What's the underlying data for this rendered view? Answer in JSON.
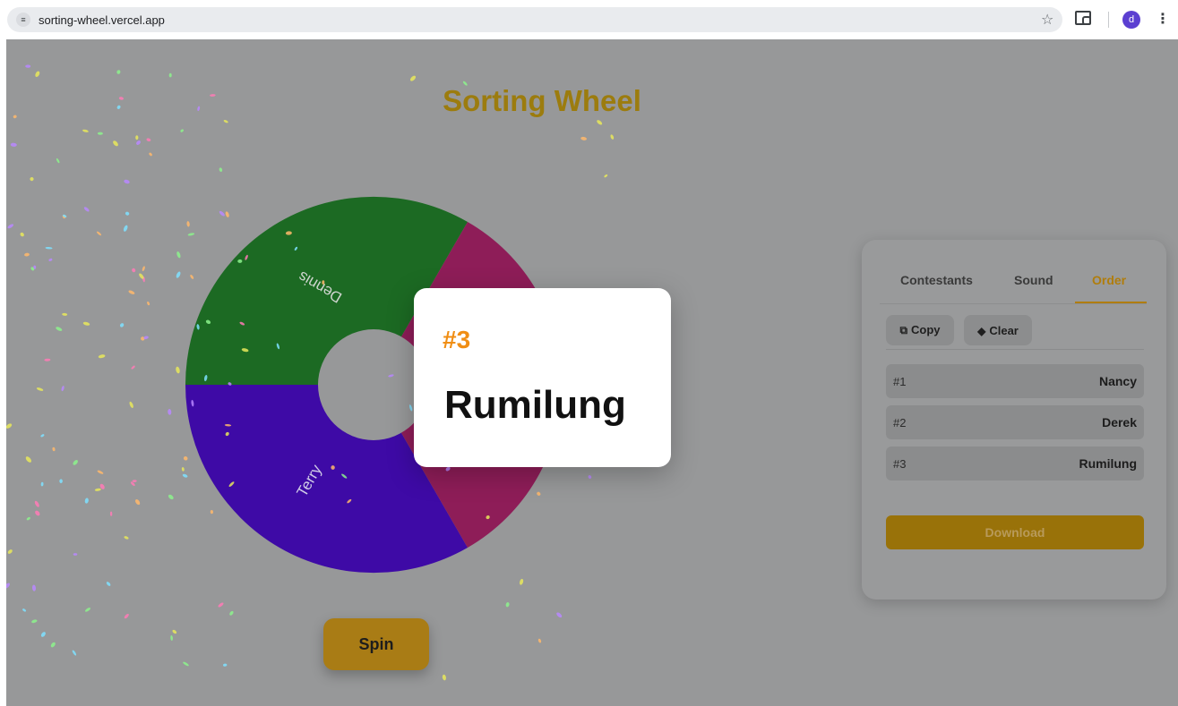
{
  "browser": {
    "url": "sorting-wheel.vercel.app",
    "profile_initial": "d"
  },
  "app": {
    "title": "Sorting Wheel",
    "spin_label": "Spin"
  },
  "wheel": {
    "segments": [
      {
        "name": "Dennis",
        "color": "#1c6a23"
      },
      {
        "name": "Terry",
        "color": "#3e0aa6"
      },
      {
        "name": "Rumilung",
        "color": "#8e1d58"
      }
    ]
  },
  "panel": {
    "tabs": [
      {
        "label": "Contestants"
      },
      {
        "label": "Sound"
      },
      {
        "label": "Order"
      }
    ],
    "active_tab": "Order",
    "copy_label": "Copy",
    "clear_label": "Clear",
    "order": [
      {
        "rank": "#1",
        "name": "Nancy"
      },
      {
        "rank": "#2",
        "name": "Derek"
      },
      {
        "rank": "#3",
        "name": "Rumilung"
      }
    ],
    "download_label": "Download"
  },
  "result": {
    "rank": "#3",
    "name": "Rumilung"
  },
  "colors": {
    "accent": "#b07d0c",
    "overlay": "#979899",
    "result_rank": "#f08e14"
  }
}
